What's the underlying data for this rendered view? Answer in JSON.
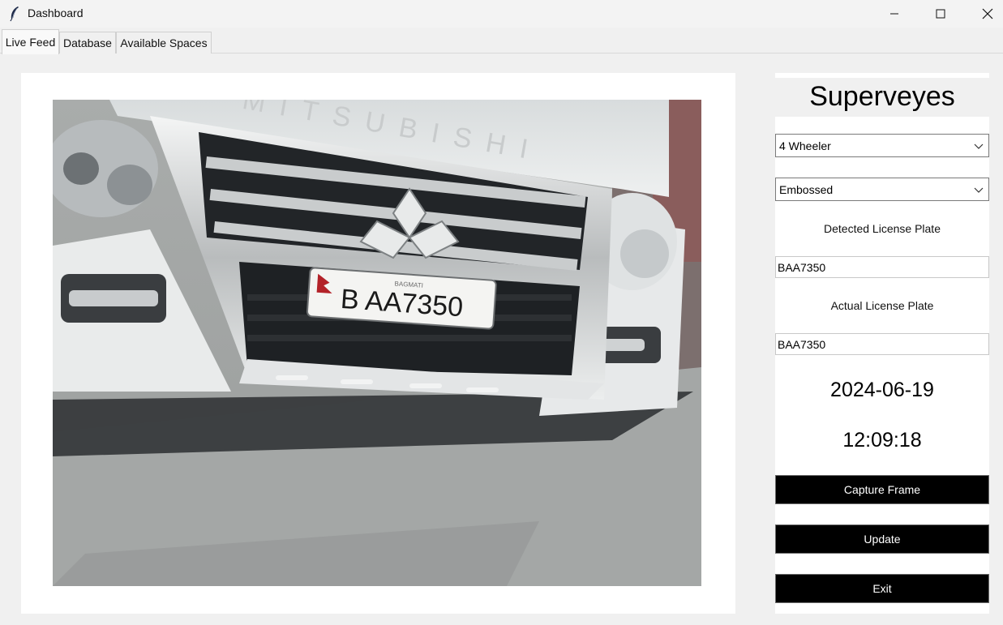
{
  "window": {
    "title": "Dashboard",
    "app_icon": "feather-icon"
  },
  "tabs": [
    {
      "label": "Live Feed",
      "active": true
    },
    {
      "label": "Database",
      "active": false
    },
    {
      "label": "Available Spaces",
      "active": false
    }
  ],
  "live_feed": {
    "camera_image": {
      "description_icon": "camera-frame",
      "plate_text": "B AA7350",
      "plate_small_text": "BAGMATI",
      "vehicle_grille_text": "MITSUBISHI"
    }
  },
  "side_panel": {
    "brand": "Superveyes",
    "vehicle_type": {
      "selected": "4 Wheeler"
    },
    "plate_type": {
      "selected": "Embossed"
    },
    "detected_label": "Detected License Plate",
    "detected_value": "BAA7350",
    "actual_label": "Actual License Plate",
    "actual_value": "BAA7350",
    "date": "2024-06-19",
    "time": "12:09:18",
    "buttons": {
      "capture": "Capture Frame",
      "update": "Update",
      "exit": "Exit"
    }
  },
  "colors": {
    "button_bg": "#000000",
    "button_fg": "#ffffff",
    "window_bg": "#f0f0f0",
    "panel_bg": "#ffffff"
  }
}
